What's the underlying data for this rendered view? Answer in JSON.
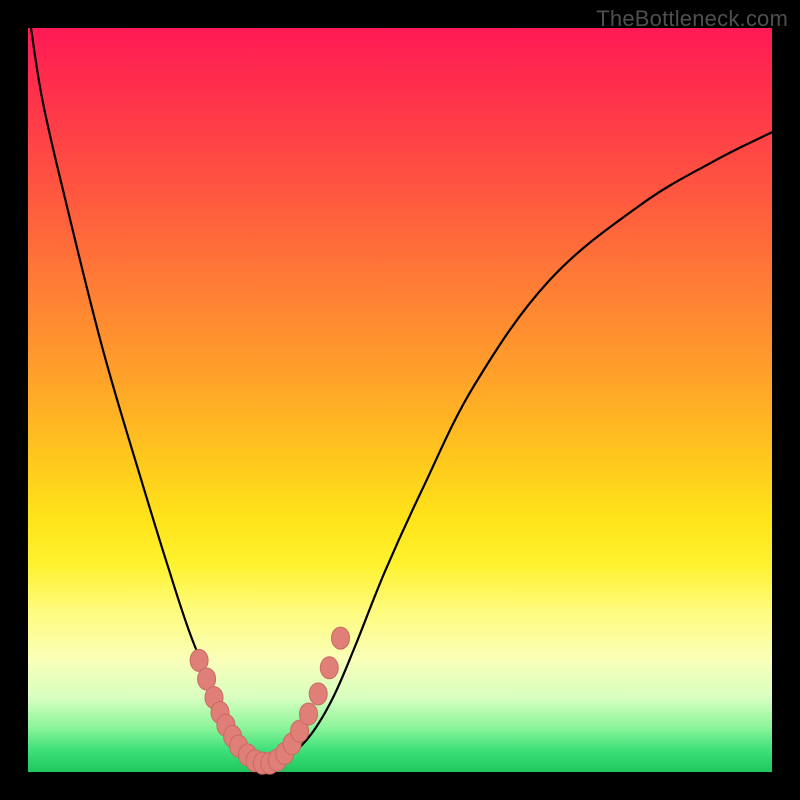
{
  "watermark": "TheBottleneck.com",
  "colors": {
    "frame": "#000000",
    "curve_stroke": "#000000",
    "marker_fill": "#e07f78",
    "marker_stroke": "#c96a63"
  },
  "chart_data": {
    "type": "line",
    "title": "",
    "xlabel": "",
    "ylabel": "",
    "xlim": [
      0,
      100
    ],
    "ylim": [
      0,
      100
    ],
    "series": [
      {
        "name": "bottleneck-curve",
        "x": [
          0.4,
          2,
          5,
          10,
          15,
          19,
          22,
          25,
          27,
          29,
          31,
          33,
          35,
          38,
          41,
          44,
          48,
          53,
          60,
          70,
          82,
          92,
          100
        ],
        "y": [
          100,
          90,
          77,
          57,
          40,
          27,
          18,
          11,
          6,
          2.5,
          1,
          1,
          2,
          5,
          10,
          17,
          27,
          38,
          52,
          66,
          76,
          82,
          86
        ]
      }
    ],
    "markers": {
      "name": "highlight-points",
      "x": [
        23.0,
        24.0,
        25.0,
        25.8,
        26.6,
        27.5,
        28.3,
        29.5,
        30.5,
        31.5,
        32.5,
        33.5,
        34.5,
        35.5,
        36.5,
        37.7,
        39.0,
        40.5,
        42.0
      ],
      "y": [
        15.0,
        12.5,
        10.0,
        8.0,
        6.3,
        4.8,
        3.5,
        2.3,
        1.5,
        1.2,
        1.2,
        1.6,
        2.5,
        3.8,
        5.5,
        7.8,
        10.5,
        14.0,
        18.0
      ]
    }
  }
}
